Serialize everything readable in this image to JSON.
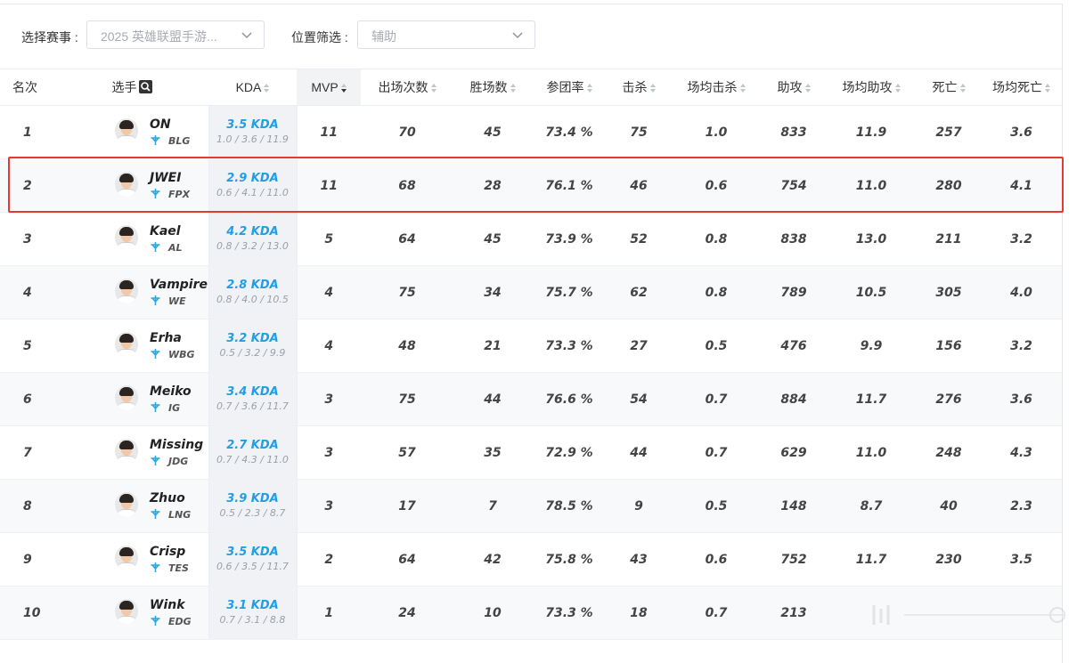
{
  "filters": {
    "event_label": "选择赛事 :",
    "event_value": "2025 英雄联盟手游...",
    "position_label": "位置筛选 :",
    "position_value": "辅助"
  },
  "columns": {
    "rank": "名次",
    "player": "选手",
    "kda": "KDA",
    "mvp": "MVP",
    "games": "出场次数",
    "wins": "胜场数",
    "kp": "参团率",
    "kills": "击杀",
    "avg_kills": "场均击杀",
    "assists": "助攻",
    "avg_assists": "场均助攻",
    "deaths": "死亡",
    "avg_deaths": "场均死亡"
  },
  "colors": {
    "kda_accent": "#1e9fe8",
    "highlight_border": "#e53935"
  },
  "rows": [
    {
      "rank": "1",
      "name": "ON",
      "team": "BLG",
      "kda": "3.5 KDA",
      "kda_detail": "1.0 / 3.6 / 11.9",
      "mvp": "11",
      "games": "70",
      "wins": "45",
      "kp": "73.4 %",
      "kills": "75",
      "avg_kills": "1.0",
      "assists": "833",
      "avg_assists": "11.9",
      "deaths": "257",
      "avg_deaths": "3.6"
    },
    {
      "rank": "2",
      "name": "JWEI",
      "team": "FPX",
      "kda": "2.9 KDA",
      "kda_detail": "0.6 / 4.1 / 11.0",
      "mvp": "11",
      "games": "68",
      "wins": "28",
      "kp": "76.1 %",
      "kills": "46",
      "avg_kills": "0.6",
      "assists": "754",
      "avg_assists": "11.0",
      "deaths": "280",
      "avg_deaths": "4.1"
    },
    {
      "rank": "3",
      "name": "Kael",
      "team": "AL",
      "kda": "4.2 KDA",
      "kda_detail": "0.8 / 3.2 / 13.0",
      "mvp": "5",
      "games": "64",
      "wins": "45",
      "kp": "73.9 %",
      "kills": "52",
      "avg_kills": "0.8",
      "assists": "838",
      "avg_assists": "13.0",
      "deaths": "211",
      "avg_deaths": "3.2"
    },
    {
      "rank": "4",
      "name": "Vampire",
      "team": "WE",
      "kda": "2.8 KDA",
      "kda_detail": "0.8 / 4.0 / 10.5",
      "mvp": "4",
      "games": "75",
      "wins": "34",
      "kp": "75.7 %",
      "kills": "62",
      "avg_kills": "0.8",
      "assists": "789",
      "avg_assists": "10.5",
      "deaths": "305",
      "avg_deaths": "4.0"
    },
    {
      "rank": "5",
      "name": "Erha",
      "team": "WBG",
      "kda": "3.2 KDA",
      "kda_detail": "0.5 / 3.2 / 9.9",
      "mvp": "4",
      "games": "48",
      "wins": "21",
      "kp": "73.3 %",
      "kills": "27",
      "avg_kills": "0.5",
      "assists": "476",
      "avg_assists": "9.9",
      "deaths": "156",
      "avg_deaths": "3.2"
    },
    {
      "rank": "6",
      "name": "Meiko",
      "team": "IG",
      "kda": "3.4 KDA",
      "kda_detail": "0.7 / 3.6 / 11.7",
      "mvp": "3",
      "games": "75",
      "wins": "44",
      "kp": "76.6 %",
      "kills": "54",
      "avg_kills": "0.7",
      "assists": "884",
      "avg_assists": "11.7",
      "deaths": "276",
      "avg_deaths": "3.6"
    },
    {
      "rank": "7",
      "name": "Missing",
      "team": "JDG",
      "kda": "2.7 KDA",
      "kda_detail": "0.7 / 4.3 / 11.0",
      "mvp": "3",
      "games": "57",
      "wins": "35",
      "kp": "72.9 %",
      "kills": "44",
      "avg_kills": "0.7",
      "assists": "629",
      "avg_assists": "11.0",
      "deaths": "248",
      "avg_deaths": "4.3"
    },
    {
      "rank": "8",
      "name": "Zhuo",
      "team": "LNG",
      "kda": "3.9 KDA",
      "kda_detail": "0.5 / 2.3 / 8.7",
      "mvp": "3",
      "games": "17",
      "wins": "7",
      "kp": "78.5 %",
      "kills": "9",
      "avg_kills": "0.5",
      "assists": "148",
      "avg_assists": "8.7",
      "deaths": "40",
      "avg_deaths": "2.3"
    },
    {
      "rank": "9",
      "name": "Crisp",
      "team": "TES",
      "kda": "3.5 KDA",
      "kda_detail": "0.6 / 3.5 / 11.7",
      "mvp": "2",
      "games": "64",
      "wins": "42",
      "kp": "75.8 %",
      "kills": "43",
      "avg_kills": "0.6",
      "assists": "752",
      "avg_assists": "11.7",
      "deaths": "230",
      "avg_deaths": "3.5"
    },
    {
      "rank": "10",
      "name": "Wink",
      "team": "EDG",
      "kda": "3.1 KDA",
      "kda_detail": "0.7 / 3.1 / 8.8",
      "mvp": "1",
      "games": "24",
      "wins": "10",
      "kp": "73.3 %",
      "kills": "18",
      "avg_kills": "0.7",
      "assists": "213",
      "avg_assists": "",
      "deaths": "",
      "avg_deaths": ""
    }
  ]
}
